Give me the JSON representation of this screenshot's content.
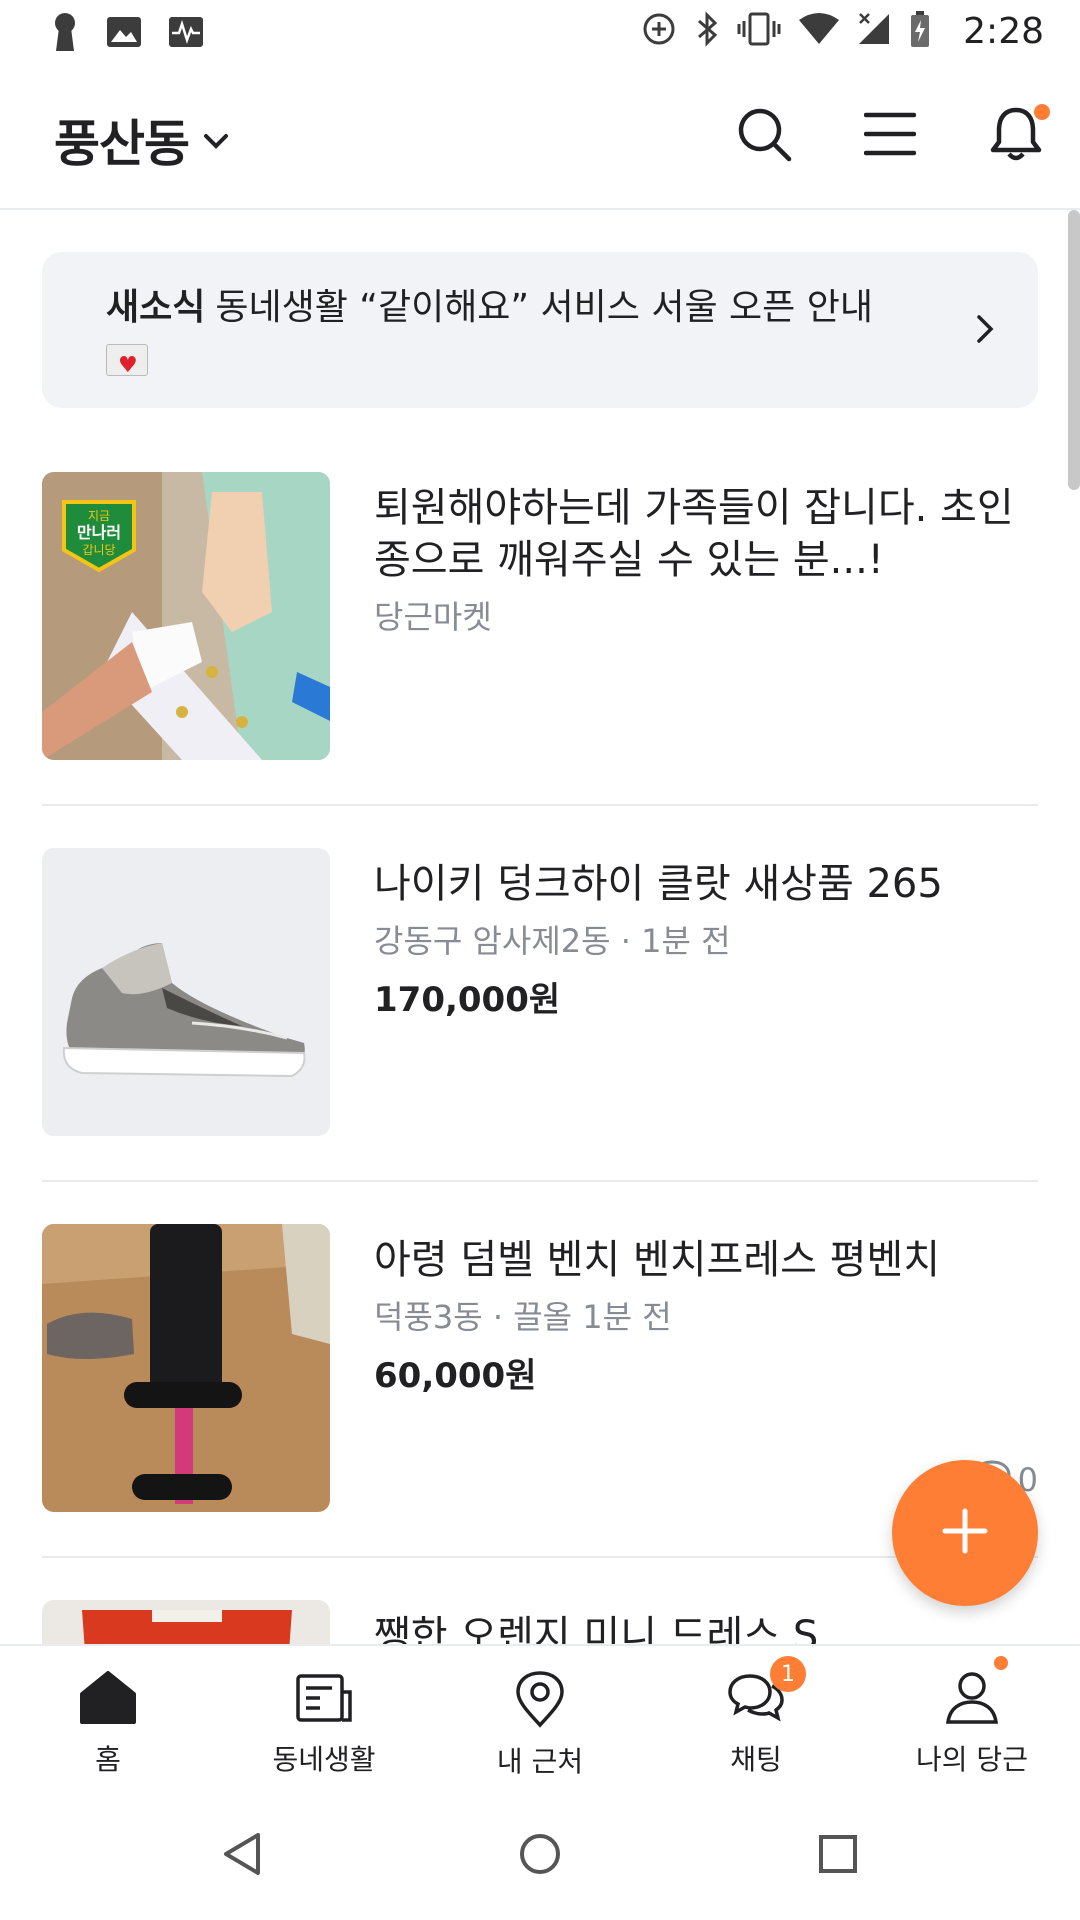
{
  "status_bar": {
    "time": "2:28",
    "left_icons": [
      "keyhole-icon",
      "image-icon",
      "activity-icon"
    ],
    "right_icons": [
      "data-saver-icon",
      "bluetooth-icon",
      "vibrate-icon",
      "wifi-icon",
      "signal-icon",
      "battery-icon"
    ]
  },
  "header": {
    "location": "풍산동",
    "icons": [
      "search-icon",
      "menu-icon",
      "bell-icon"
    ]
  },
  "news": {
    "tag": "새소식",
    "text": "동네생활 “같이해요” 서비스 서울 오픈 안내"
  },
  "items": [
    {
      "title": "퇴원해야하는데 가족들이 잡니다. 초인종으로 깨워주실 수 있는 분...!",
      "meta": "당근마켓",
      "price": "",
      "thumb_badge": [
        "지금",
        "만나러",
        "갑니당"
      ]
    },
    {
      "title": "나이키 덩크하이 클랏 새상품 265",
      "meta": "강동구 암사제2동 · 1분 전",
      "price": "170,000원"
    },
    {
      "title": "아령 덤벨 벤치 벤치프레스 평벤치",
      "meta": "덕풍3동 · 끌올 1분 전",
      "price": "60,000원",
      "chat_count": "0"
    },
    {
      "title": "쨍한 오렌지 미니 드레스 S",
      "meta": "",
      "price": ""
    }
  ],
  "fab_label": "+",
  "bottom_nav": [
    {
      "label": "홈",
      "icon": "home-icon"
    },
    {
      "label": "동네생활",
      "icon": "news-icon"
    },
    {
      "label": "내 근처",
      "icon": "location-icon"
    },
    {
      "label": "채팅",
      "icon": "chat-icon",
      "badge": "1"
    },
    {
      "label": "나의 당근",
      "icon": "person-icon"
    }
  ],
  "system_nav": [
    "back-icon",
    "home-circle-icon",
    "recents-icon"
  ],
  "colors": {
    "accent": "#ff7e36",
    "text": "#212124",
    "subtext": "#868b94"
  }
}
